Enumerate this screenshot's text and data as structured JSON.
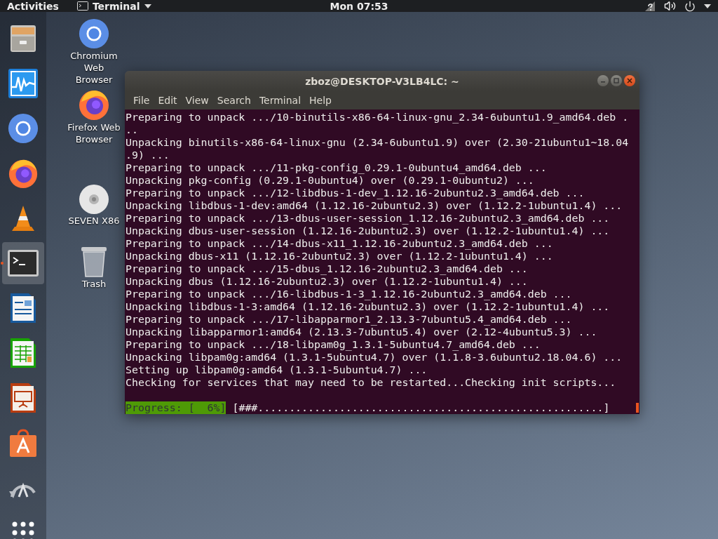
{
  "top_bar": {
    "activities": "Activities",
    "app_menu": "Terminal",
    "clock": "Mon 07:53"
  },
  "dock": [
    {
      "kind": "files",
      "selected": false
    },
    {
      "kind": "monitor",
      "selected": false
    },
    {
      "kind": "chromium",
      "selected": false
    },
    {
      "kind": "firefox",
      "selected": false
    },
    {
      "kind": "vlc",
      "selected": false
    },
    {
      "kind": "terminal",
      "selected": true
    },
    {
      "kind": "writer",
      "selected": false
    },
    {
      "kind": "calc",
      "selected": false
    },
    {
      "kind": "impress",
      "selected": false
    },
    {
      "kind": "software",
      "selected": false
    },
    {
      "kind": "updater",
      "selected": false
    },
    {
      "kind": "apps",
      "selected": false
    }
  ],
  "desktop_icons": [
    {
      "kind": "chromium",
      "label": "Chromium Web Browser"
    },
    {
      "kind": "firefox",
      "label": "Firefox Web Browser"
    },
    {
      "kind": "disc",
      "label": "SEVEN X86"
    },
    {
      "kind": "trash",
      "label": "Trash"
    }
  ],
  "window": {
    "title": "zboz@DESKTOP-V3LB4LC: ~",
    "menu": [
      "File",
      "Edit",
      "View",
      "Search",
      "Terminal",
      "Help"
    ],
    "lines": [
      "Preparing to unpack .../10-binutils-x86-64-linux-gnu_2.34-6ubuntu1.9_amd64.deb .",
      "..",
      "Unpacking binutils-x86-64-linux-gnu (2.34-6ubuntu1.9) over (2.30-21ubuntu1~18.04",
      ".9) ...",
      "Preparing to unpack .../11-pkg-config_0.29.1-0ubuntu4_amd64.deb ...",
      "Unpacking pkg-config (0.29.1-0ubuntu4) over (0.29.1-0ubuntu2) ...",
      "Preparing to unpack .../12-libdbus-1-dev_1.12.16-2ubuntu2.3_amd64.deb ...",
      "Unpacking libdbus-1-dev:amd64 (1.12.16-2ubuntu2.3) over (1.12.2-1ubuntu1.4) ...",
      "Preparing to unpack .../13-dbus-user-session_1.12.16-2ubuntu2.3_amd64.deb ...",
      "Unpacking dbus-user-session (1.12.16-2ubuntu2.3) over (1.12.2-1ubuntu1.4) ...",
      "Preparing to unpack .../14-dbus-x11_1.12.16-2ubuntu2.3_amd64.deb ...",
      "Unpacking dbus-x11 (1.12.16-2ubuntu2.3) over (1.12.2-1ubuntu1.4) ...",
      "Preparing to unpack .../15-dbus_1.12.16-2ubuntu2.3_amd64.deb ...",
      "Unpacking dbus (1.12.16-2ubuntu2.3) over (1.12.2-1ubuntu1.4) ...",
      "Preparing to unpack .../16-libdbus-1-3_1.12.16-2ubuntu2.3_amd64.deb ...",
      "Unpacking libdbus-1-3:amd64 (1.12.16-2ubuntu2.3) over (1.12.2-1ubuntu1.4) ...",
      "Preparing to unpack .../17-libapparmor1_2.13.3-7ubuntu5.4_amd64.deb ...",
      "Unpacking libapparmor1:amd64 (2.13.3-7ubuntu5.4) over (2.12-4ubuntu5.3) ...",
      "Preparing to unpack .../18-libpam0g_1.3.1-5ubuntu4.7_amd64.deb ...",
      "Unpacking libpam0g:amd64 (1.3.1-5ubuntu4.7) over (1.1.8-3.6ubuntu2.18.04.6) ...",
      "Setting up libpam0g:amd64 (1.3.1-5ubuntu4.7) ...",
      "Checking for services that may need to be restarted...Checking init scripts..."
    ],
    "progress": {
      "label": "Progress: [  6%]",
      "bar": "[###.......................................................]"
    }
  }
}
